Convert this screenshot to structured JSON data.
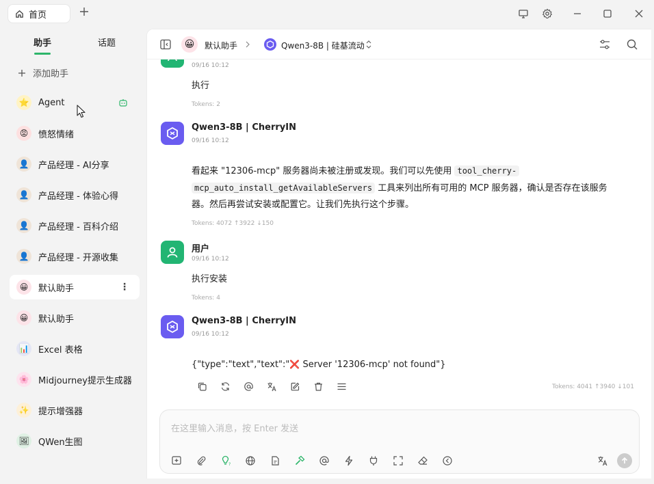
{
  "titlebar": {
    "home_tab": "首页"
  },
  "sidebar": {
    "tabs": [
      "助手",
      "话题"
    ],
    "add_label": "添加助手",
    "items": [
      {
        "label": "Agent",
        "emoji": "⭐"
      },
      {
        "label": "愤怒情绪",
        "emoji": "😡"
      },
      {
        "label": "产品经理 - AI分享",
        "emoji": "👤"
      },
      {
        "label": "产品经理 - 体验心得",
        "emoji": "👤"
      },
      {
        "label": "产品经理 - 百科介绍",
        "emoji": "👤"
      },
      {
        "label": "产品经理 - 开源收集",
        "emoji": "👤"
      },
      {
        "label": "默认助手",
        "emoji": "😀"
      },
      {
        "label": "默认助手",
        "emoji": "😀"
      },
      {
        "label": "Excel 表格",
        "emoji": "📊"
      },
      {
        "label": "Midjourney提示生成器",
        "emoji": "🌸"
      },
      {
        "label": "提示增强器",
        "emoji": "✨"
      },
      {
        "label": "QWen生图",
        "emoji": "🖼"
      }
    ]
  },
  "header": {
    "assistant": "默认助手",
    "model": "Qwen3-8B | 硅基流动"
  },
  "messages": [
    {
      "time": "09/16 10:12",
      "text": "执行",
      "tokens": "Tokens: 2"
    },
    {
      "name": "Qwen3-8B | CherryIN",
      "time": "09/16 10:12",
      "text_a": "看起来 \"12306-mcp\" 服务器尚未被注册或发现。我们可以先使用 ",
      "code_a": "tool_cherry-",
      "code_b": "mcp_auto_install_getAvailableServers",
      "text_b": " 工具来列出所有可用的 MCP 服务器，确认是否存在该服务",
      "text_c": "器。然后再尝试安装或配置它。让我们先执行这个步骤。",
      "tokens": "Tokens: 4072 ↑3922 ↓150"
    },
    {
      "name": "用户",
      "time": "09/16 10:12",
      "text": "执行安装",
      "tokens": "Tokens: 4"
    },
    {
      "name": "Qwen3-8B | CherryIN",
      "time": "09/16 10:12",
      "text_a": "{\"type\":\"text\",\"text\":\"",
      "cross": "❌",
      "text_b": " Server '12306-mcp' not found\"}",
      "tokens": "Tokens: 4041 ↑3940 ↓101"
    }
  ],
  "input": {
    "placeholder": "在这里输入消息，按 Enter 发送"
  },
  "colors": {
    "accent": "#2db56a",
    "qwen": "#6a5cf0",
    "user_avatar": "#22b573"
  }
}
